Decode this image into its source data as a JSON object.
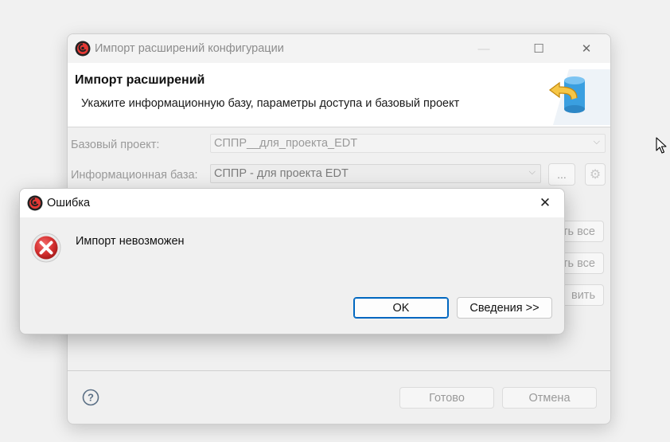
{
  "main_window": {
    "title": "Импорт расширений конфигурации",
    "controls": {
      "minimize": "—",
      "maximize": "☐",
      "close": "✕"
    },
    "header": {
      "title": "Импорт расширений",
      "description": "Укажите информационную базу, параметры доступа и базовый проект"
    },
    "form": {
      "base_project_label": "Базовый проект:",
      "base_project_value": "СППР__для_проекта_EDT",
      "infobase_label": "Информационная база:",
      "infobase_value": "СППР - для проекта EDT",
      "browse_label": "..."
    },
    "side_buttons": [
      "ть все",
      "ть все",
      "вить"
    ],
    "footer": {
      "finish_label": "Готово",
      "cancel_label": "Отмена"
    }
  },
  "error_dialog": {
    "title": "Ошибка",
    "message": "Импорт невозможен",
    "ok_label": "OK",
    "details_label": "Сведения >>",
    "close_glyph": "✕"
  },
  "colors": {
    "accent": "#0067c0",
    "error_red": "#d32f2f",
    "disabled_text": "#9a9a9a"
  },
  "icons": [
    "app-icon",
    "database-arrow-icon",
    "help-icon",
    "error-icon",
    "chevron-down-icon",
    "gear-icon",
    "close-icon",
    "mouse-cursor-icon"
  ]
}
